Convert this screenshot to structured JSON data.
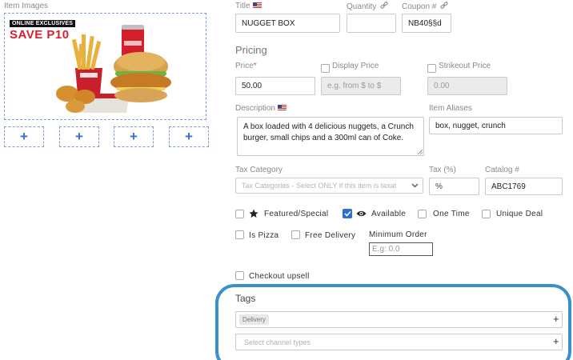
{
  "images": {
    "label": "Item Images",
    "promo_line1": "ONLINE EXCLUSIVES",
    "promo_line2": "SAVE P10",
    "add_slot": "+"
  },
  "title": {
    "label": "Title",
    "value": "NUGGET BOX"
  },
  "quantity": {
    "label": "Quantity",
    "value": ""
  },
  "coupon": {
    "label": "Coupon #",
    "value": "NB40§§d"
  },
  "pricing": {
    "heading": "Pricing",
    "price_label": "Price",
    "required_mark": "*",
    "price_value": "50.00",
    "display_price_label": "Display Price",
    "display_price_placeholder": "e.g. from $ to $",
    "strikeout_label": "Strikeout Price",
    "strikeout_placeholder": "0.00"
  },
  "description": {
    "label": "Description",
    "value": "A box loaded with 4 delicious nuggets, a Crunch burger, small chips and a 300ml can of Coke."
  },
  "aliases": {
    "label": "Item Aliases",
    "value": "box, nugget, crunch"
  },
  "tax_category": {
    "label": "Tax Category",
    "placeholder": "Tax Categories - Select ONLY if this item is taxat"
  },
  "tax": {
    "label": "Tax (%)",
    "placeholder": "%"
  },
  "catalog": {
    "label": "Catalog #",
    "value": "ABC1769"
  },
  "options": {
    "featured": "Featured/Special",
    "available": "Available",
    "one_time": "One Time",
    "unique_deal": "Unique Deal",
    "is_pizza": "Is Pizza",
    "free_delivery": "Free Delivery",
    "minimum_order_label": "Minimum Order",
    "minimum_order_placeholder": "E.g: 0.0",
    "checkout_upsell": "Checkout upsell"
  },
  "tags": {
    "heading": "Tags",
    "tag_chip": "Delivery",
    "channel_placeholder": "Select channel types",
    "add": "+"
  },
  "colors": {
    "accent": "#2f6fd0",
    "highlight_ring": "#3a90c8",
    "required": "#d9534f"
  }
}
